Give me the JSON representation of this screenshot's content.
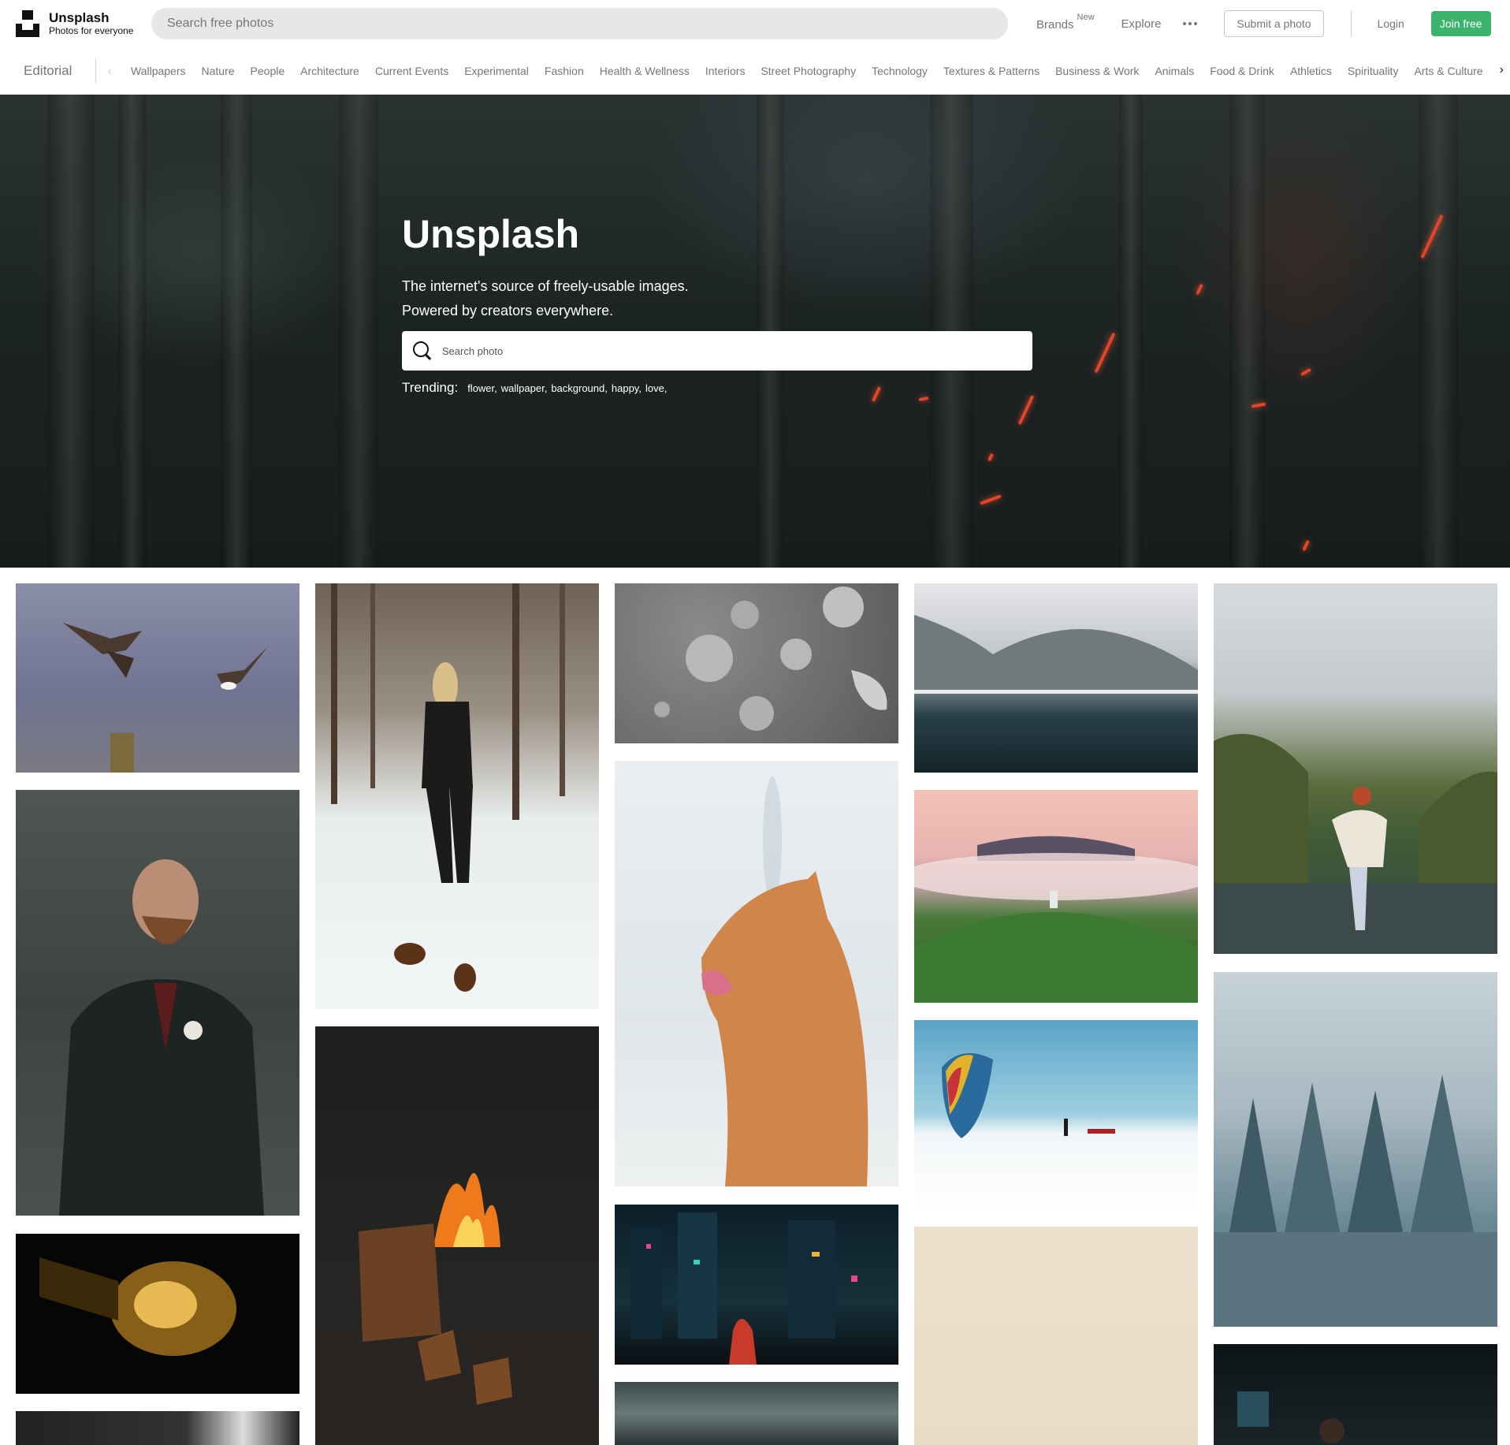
{
  "header": {
    "logo_name": "Unsplash",
    "logo_tagline": "Photos for everyone",
    "search_placeholder": "Search free photos",
    "brands_label": "Brands",
    "brands_badge": "New",
    "explore_label": "Explore",
    "submit_label": "Submit a photo",
    "login_label": "Login",
    "join_label": "Join free"
  },
  "catbar": {
    "editorial_label": "Editorial",
    "categories": [
      "Wallpapers",
      "Nature",
      "People",
      "Architecture",
      "Current Events",
      "Experimental",
      "Fashion",
      "Health & Wellness",
      "Interiors",
      "Street Photography",
      "Technology",
      "Textures & Patterns",
      "Business & Work",
      "Animals",
      "Food & Drink",
      "Athletics",
      "Spirituality",
      "Arts & Culture"
    ]
  },
  "hero": {
    "title": "Unsplash",
    "subtitle_line1": "The internet's source of freely-usable images.",
    "subtitle_line2": "Powered by creators everywhere.",
    "search_placeholder": "Search photo",
    "trending_label": "Trending:",
    "trending": [
      "flower,",
      "wallpaper,",
      "background,",
      "happy,",
      "love,"
    ]
  },
  "colors": {
    "accent_green": "#3cb46e",
    "nav_gray": "#767676"
  },
  "photos": [
    {
      "name": "photo-eagles",
      "subject": "eagles"
    },
    {
      "name": "photo-bearded-man-suit",
      "subject": "man in suit"
    },
    {
      "name": "photo-light-bulb",
      "subject": "light bulb"
    },
    {
      "name": "photo-dark-partial",
      "subject": "dark partial"
    },
    {
      "name": "photo-woman-snow-forest",
      "subject": "woman in snowy forest"
    },
    {
      "name": "photo-campfire-backpack",
      "subject": "campfire and backpack"
    },
    {
      "name": "photo-water-drops",
      "subject": "water drops"
    },
    {
      "name": "photo-orange-cat",
      "subject": "orange cat"
    },
    {
      "name": "photo-neon-city",
      "subject": "neon city"
    },
    {
      "name": "photo-stormy-sky",
      "subject": "stormy sky"
    },
    {
      "name": "photo-mountain-lake",
      "subject": "mountain lake"
    },
    {
      "name": "photo-foggy-hill-church",
      "subject": "foggy hill with church"
    },
    {
      "name": "photo-snow-kite",
      "subject": "snow kite"
    },
    {
      "name": "photo-beige-minimal",
      "subject": "beige minimal"
    },
    {
      "name": "photo-river-walker",
      "subject": "person in river"
    },
    {
      "name": "photo-snowy-pines",
      "subject": "snowy pines"
    },
    {
      "name": "photo-dark-room",
      "subject": "dark room"
    }
  ]
}
